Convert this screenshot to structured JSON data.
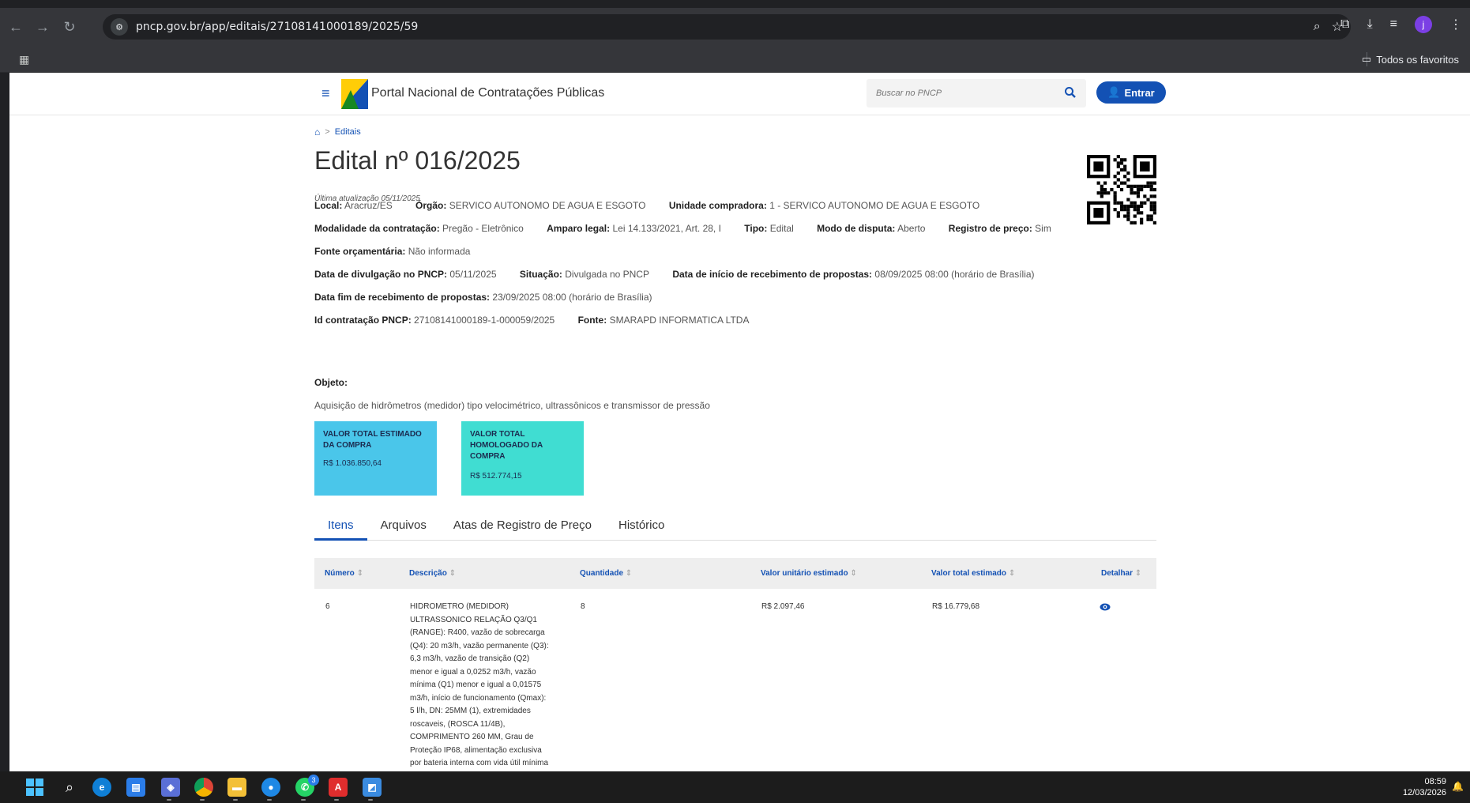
{
  "browser": {
    "url": "pncp.gov.br/app/editais/27108141000189/2025/59",
    "bookmarks_folder": "Todos os favoritos",
    "profile_initial": "j"
  },
  "header": {
    "portal_title": "Portal Nacional de Contratações Públicas",
    "search_placeholder": "Buscar no PNCP",
    "login_label": "Entrar"
  },
  "breadcrumb": {
    "current": "Editais"
  },
  "edital": {
    "title": "Edital nº 016/2025",
    "updated": "Última atualização 05/11/2025",
    "fields": {
      "local_label": "Local:",
      "local": "Aracruz/ES",
      "orgao_label": "Órgão:",
      "orgao": "SERVICO AUTONOMO DE AGUA E ESGOTO",
      "unidade_label": "Unidade compradora:",
      "unidade": "1 - SERVICO AUTONOMO DE AGUA E ESGOTO",
      "modalidade_label": "Modalidade da contratação:",
      "modalidade": "Pregão - Eletrônico",
      "amparo_label": "Amparo legal:",
      "amparo": "Lei 14.133/2021, Art. 28, I",
      "tipo_label": "Tipo:",
      "tipo": "Edital",
      "modo_label": "Modo de disputa:",
      "modo": "Aberto",
      "registro_label": "Registro de preço:",
      "registro": "Sim",
      "fonte_orc_label": "Fonte orçamentária:",
      "fonte_orc": "Não informada",
      "divulgacao_label": "Data de divulgação no PNCP:",
      "divulgacao": "05/11/2025",
      "situacao_label": "Situação:",
      "situacao": "Divulgada no PNCP",
      "inicio_label": "Data de início de recebimento de propostas:",
      "inicio": "08/09/2025 08:00 (horário de Brasília)",
      "fim_label": "Data fim de recebimento de propostas:",
      "fim": "23/09/2025 08:00 (horário de Brasília)",
      "id_label": "Id contratação PNCP:",
      "id": "27108141000189-1-000059/2025",
      "fonte_label": "Fonte:",
      "fonte": "SMARAPD INFORMATICA LTDA",
      "objeto_label": "Objeto:",
      "objeto": "Aquisição de hidrômetros (medidor) tipo velocimétrico, ultrassônicos e transmissor de pressão"
    },
    "cards": [
      {
        "label": "VALOR TOTAL ESTIMADO DA COMPRA",
        "value": "R$ 1.036.850,64",
        "color": "#4ac6ea"
      },
      {
        "label": "VALOR TOTAL HOMOLOGADO DA COMPRA",
        "value": "R$ 512.774,15",
        "color": "#40ddd2"
      }
    ]
  },
  "tabs": [
    {
      "label": "Itens",
      "active": true
    },
    {
      "label": "Arquivos",
      "active": false
    },
    {
      "label": "Atas de Registro de Preço",
      "active": false
    },
    {
      "label": "Histórico",
      "active": false
    }
  ],
  "table": {
    "columns": [
      "Número",
      "Descrição",
      "Quantidade",
      "Valor unitário estimado",
      "Valor total estimado",
      "Detalhar"
    ],
    "sort_glyph": "⇕",
    "rows": [
      {
        "numero": "6",
        "descricao_lines": [
          "HIDROMETRO (MEDIDOR)",
          "ULTRASSONICO RELAÇÃO Q3/Q1",
          "(RANGE): R400, vazão de sobrecarga",
          "(Q4): 20 m3/h, vazão permanente (Q3):",
          "6,3 m3/h, vazão de transição (Q2)",
          "menor e igual a 0,0252 m3/h, vazão",
          "mínima (Q1) menor e igual a 0,01575",
          "m3/h, início de funcionamento (Qmax):",
          "5 l/h, DN: 25MM (1), extremidades",
          "roscaveis, (ROSCA 11/4B),",
          "COMPRIMENTO 260 MM, Grau de",
          "Proteção IP68, alimentação exclusiva",
          "por bateria interna com vida útil mínima"
        ],
        "quantidade": "8",
        "valor_unitario": "R$ 2.097,46",
        "valor_total": "R$ 16.779,68"
      }
    ]
  },
  "taskbar": {
    "time": "08:59",
    "date": "12/03/2026",
    "whatsapp_badge": "3"
  },
  "colors": {
    "brand_blue": "#1351b4",
    "card_estimated": "#4ac6ea",
    "card_homologated": "#40ddd2"
  }
}
